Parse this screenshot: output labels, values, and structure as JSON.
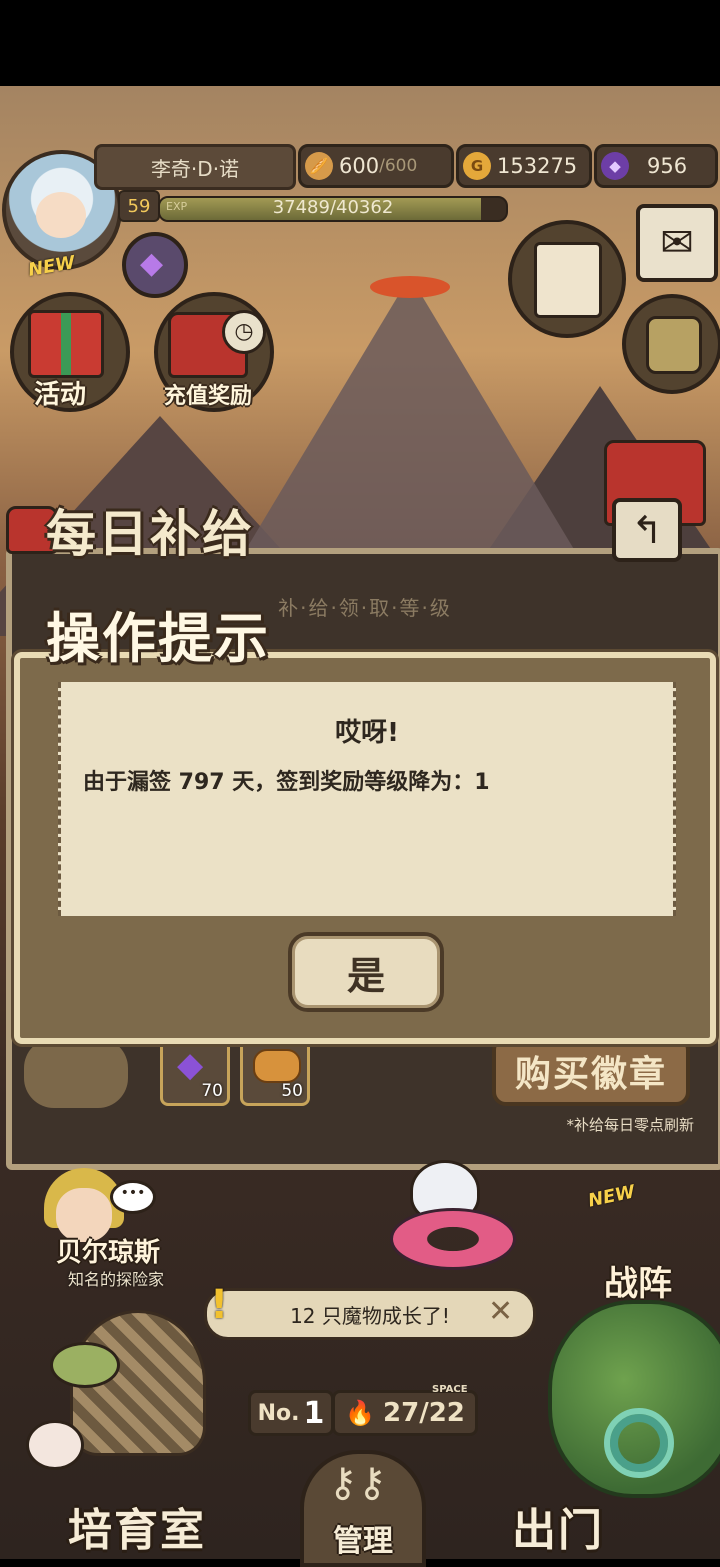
{
  "player": {
    "name": "李奇·D·诺",
    "level": "59",
    "exp_label": "EXP",
    "exp_text": "37489/40362",
    "exp_fraction": 0.929,
    "avatar_badge": "NEW"
  },
  "resources": {
    "stamina": {
      "value": "600",
      "max": "/600"
    },
    "gold": {
      "value": "153275"
    },
    "gems": {
      "value": "956"
    }
  },
  "menu": {
    "activity_label": "活动",
    "recharge_label": "充值奖励"
  },
  "daily_supply": {
    "title": "每日补给",
    "subtitle": "补·给·领·取·等·级",
    "rewards": [
      {
        "icon": "purple-gem-icon",
        "qty": "70"
      },
      {
        "icon": "bread-icon",
        "qty": "50"
      }
    ],
    "buy_button": "购买徽章",
    "refresh_note": "*补给每日零点刷新"
  },
  "dialog": {
    "header": "操作提示",
    "title": "哎呀!",
    "message": "由于漏签 797 天，签到奖励等级降为：1",
    "confirm": "是"
  },
  "bottom": {
    "npc_name": "贝尔琼斯",
    "npc_title": "知名的探险家",
    "npc_speech": "•••",
    "battle_label": "战阵",
    "battle_badge": "NEW",
    "notification": "12 只魔物成长了!",
    "rank_prefix": "No.",
    "rank_value": "1",
    "space_value": "27/22",
    "space_label": "SPACE",
    "nav": {
      "nursery": "培育室",
      "manage": "管理",
      "go_out": "出门"
    }
  },
  "colors": {
    "dialog_border": "#e9dbb4",
    "paper": "#ebe1c6",
    "accent_red": "#e2342c"
  }
}
